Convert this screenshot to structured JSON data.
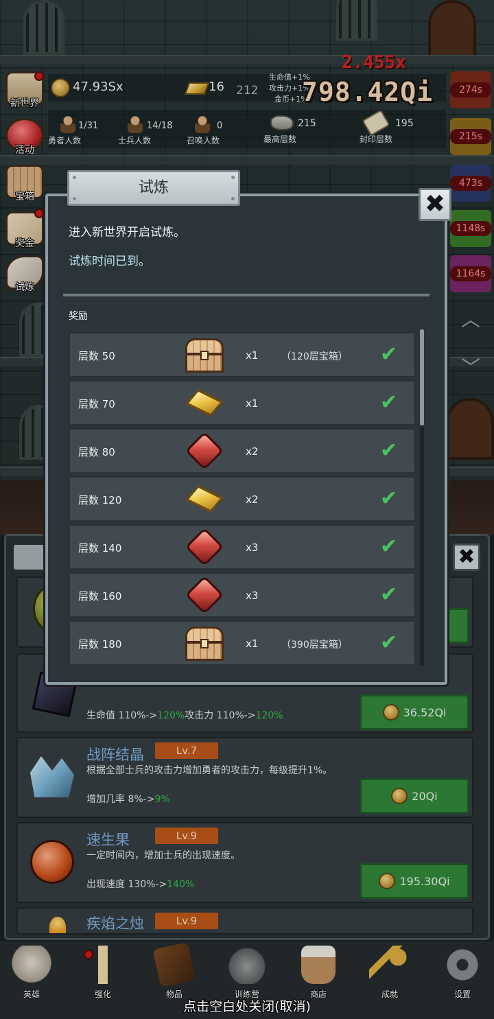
{
  "hud": {
    "gold": "47.93Sx",
    "gold_bars": "16",
    "gold_bars_extra": "212",
    "bonus": {
      "hp": "生命值+1%",
      "atk": "攻击力+1%",
      "coin": "金币+1%"
    },
    "damage_big": "798.42Qi",
    "damage_red": "2.455x",
    "hero_count": {
      "value": "1/31",
      "label": "勇者人数"
    },
    "soldier_count": {
      "value": "14/18",
      "label": "士兵人数"
    },
    "summon_count": {
      "value": "0",
      "label": "召唤人数"
    },
    "top_floor": {
      "value": "215",
      "label": "最高层数"
    },
    "sealed_floor": {
      "value": "195",
      "label": "封印层数"
    }
  },
  "left_menu": [
    {
      "label": "新世界",
      "badge": true
    },
    {
      "label": "活动",
      "badge": false
    },
    {
      "label": "宝箱",
      "badge": false
    },
    {
      "label": "奖金",
      "badge": true
    },
    {
      "label": "试炼",
      "badge": false
    }
  ],
  "right_timers": [
    "274s",
    "215s",
    "473s",
    "1148s",
    "1164s"
  ],
  "dialog": {
    "title": "试炼",
    "line1": "进入新世界开启试炼。",
    "line2": "试炼时间已到。",
    "reward_label": "奖励",
    "rewards": [
      {
        "floor": "层数 50",
        "item": "chest",
        "qty": "x1",
        "note": "（120层宝箱）",
        "claimed": true
      },
      {
        "floor": "层数 70",
        "item": "gold",
        "qty": "x1",
        "note": "",
        "claimed": true
      },
      {
        "floor": "层数 80",
        "item": "gem",
        "qty": "x2",
        "note": "",
        "claimed": true
      },
      {
        "floor": "层数 120",
        "item": "gold",
        "qty": "x2",
        "note": "",
        "claimed": true
      },
      {
        "floor": "层数 140",
        "item": "gem",
        "qty": "x3",
        "note": "",
        "claimed": true
      },
      {
        "floor": "层数 160",
        "item": "gem",
        "qty": "x3",
        "note": "",
        "claimed": true
      },
      {
        "floor": "层数 180",
        "item": "chest",
        "qty": "x1",
        "note": "（390层宝箱）",
        "claimed": true
      }
    ],
    "check_glyph": "✔",
    "close_glyph": "✖"
  },
  "upgrades": {
    "card1": {
      "stat_prefix": "生命值 110%->",
      "stat_hp_new": "120%",
      "stat_mid": "攻击力 110%->",
      "stat_atk_new": "120%",
      "price": "36.52Qi"
    },
    "card2": {
      "title": "战阵结晶",
      "level": "Lv.7",
      "desc": "根据全部士兵的攻击力增加勇者的攻击力，每级提升1%。",
      "stat_prefix": "增加几率 8%->",
      "stat_new": "9%",
      "price": "20Qi"
    },
    "card3": {
      "title": "速生果",
      "level": "Lv.9",
      "desc": "一定时间内，增加士兵的出现速度。",
      "stat_prefix": "出现速度 130%->",
      "stat_new": "140%",
      "price": "195.30Qi"
    },
    "card4": {
      "title": "疾焰之烛",
      "level": "Lv.9"
    },
    "close_glyph": "✖"
  },
  "bottom_nav": [
    {
      "label": "英雄"
    },
    {
      "label": "强化"
    },
    {
      "label": "物品"
    },
    {
      "label": "训练营"
    },
    {
      "label": "商店"
    },
    {
      "label": "成就"
    },
    {
      "label": "设置"
    }
  ],
  "close_hint": "点击空白处关闭(取消)",
  "colors": {
    "accent_green": "#35c24a",
    "buy_green": "#33893b",
    "level_orange": "#c0581a",
    "title_blue": "#7fb0e0",
    "timer_red": "#ff8a8a"
  }
}
